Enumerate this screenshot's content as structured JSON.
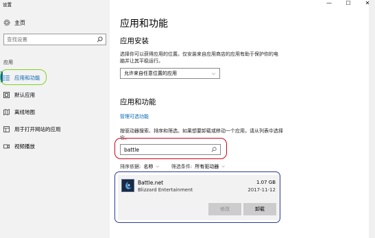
{
  "window": {
    "title": "设置",
    "controls": {
      "minimize": "—",
      "maximize": "☐",
      "close": "✕"
    }
  },
  "sidebar": {
    "home_label": "主页",
    "search_placeholder": "查找设置",
    "section_label": "应用",
    "items": [
      {
        "label": "应用和功能",
        "icon": "apps-list-icon",
        "active": true
      },
      {
        "label": "默认应用",
        "icon": "default-apps-icon",
        "active": false
      },
      {
        "label": "离线地图",
        "icon": "map-icon",
        "active": false
      },
      {
        "label": "用于打开网站的应用",
        "icon": "open-web-apps-icon",
        "active": false
      },
      {
        "label": "视频播放",
        "icon": "video-icon",
        "active": false
      }
    ]
  },
  "main": {
    "page_title": "应用和功能",
    "install_heading": "应用安装",
    "install_desc": "选择你可以获得应用的位置。仅安装来自应用商店的应用有助于保护你的电脑并让其平稳运行。",
    "install_dropdown_value": "允许来自任意位置的应用",
    "apps_heading": "应用和功能",
    "optional_link": "管理可选功能",
    "apps_desc": "按驱动器搜索、排序和筛选。如果想要卸载或移动一个应用，请从列表中选择它。",
    "app_search_value": "battle",
    "sort_label": "排序依据:",
    "sort_value": "名称",
    "filter_label": "筛选条件:",
    "filter_value": "所有驱动器"
  },
  "app": {
    "name": "Battle.net",
    "publisher": "Blizzard Entertainment",
    "size": "1.07 GB",
    "date": "2017-11-12",
    "modify_label": "修改",
    "uninstall_label": "卸载"
  },
  "colors": {
    "accent": "#0063b1",
    "highlight_green": "#7ed321",
    "highlight_red": "#d0021b",
    "highlight_blue": "#2b3a97"
  }
}
